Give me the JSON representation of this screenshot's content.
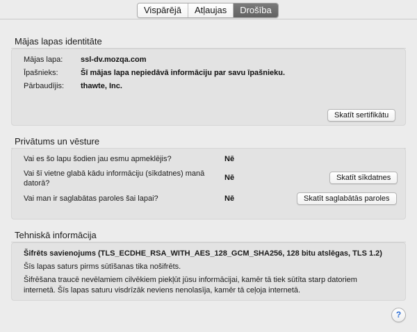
{
  "tabs": [
    {
      "label": "Vispārējā"
    },
    {
      "label": "Atļaujas"
    },
    {
      "label": "Drošība",
      "active": true
    }
  ],
  "identity": {
    "title": "Mājas lapas identitāte",
    "website_label": "Mājas lapa:",
    "website_value": "ssl-dv.mozqa.com",
    "owner_label": "Īpašnieks:",
    "owner_value": "Šī mājas lapa nepiedāvā informāciju par savu īpašnieku.",
    "verified_label": "Pārbaudījis:",
    "verified_value": "thawte, Inc.",
    "view_cert_button": "Skatīt sertifikātu"
  },
  "privacy": {
    "title": "Privātums un vēsture",
    "q1": "Vai es šo lapu šodien jau esmu apmeklējis?",
    "a1": "Nē",
    "q2_line1": "Vai šī vietne glabā kādu informāciju (sīkdatnes) manā",
    "q2_line2": "datorā?",
    "a2": "Nē",
    "cookies_button": "Skatīt sīkdatnes",
    "q3": "Vai man ir saglabātas paroles šai lapai?",
    "a3": "Nē",
    "passwords_button": "Skatīt saglabātās paroles"
  },
  "technical": {
    "title": "Tehniskā informācija",
    "connection": "Šifrēts savienojums (TLS_ECDHE_RSA_WITH_AES_128_GCM_SHA256, 128 bitu atslēgas, TLS 1.2)",
    "line2": "Šīs lapas saturs pirms sūtīšanas tika nošifrēts.",
    "line3a": "Šifrēšana traucē nevēlamiem cilvēkiem piekļūt jūsu informācijai, kamēr tā tiek sūtīta starp datoriem",
    "line3b": "internetā. Šīs lapas saturu visdrīzāk neviens nenolasīja, kamēr tā ceļoja internetā."
  },
  "help": {
    "label": "?"
  }
}
